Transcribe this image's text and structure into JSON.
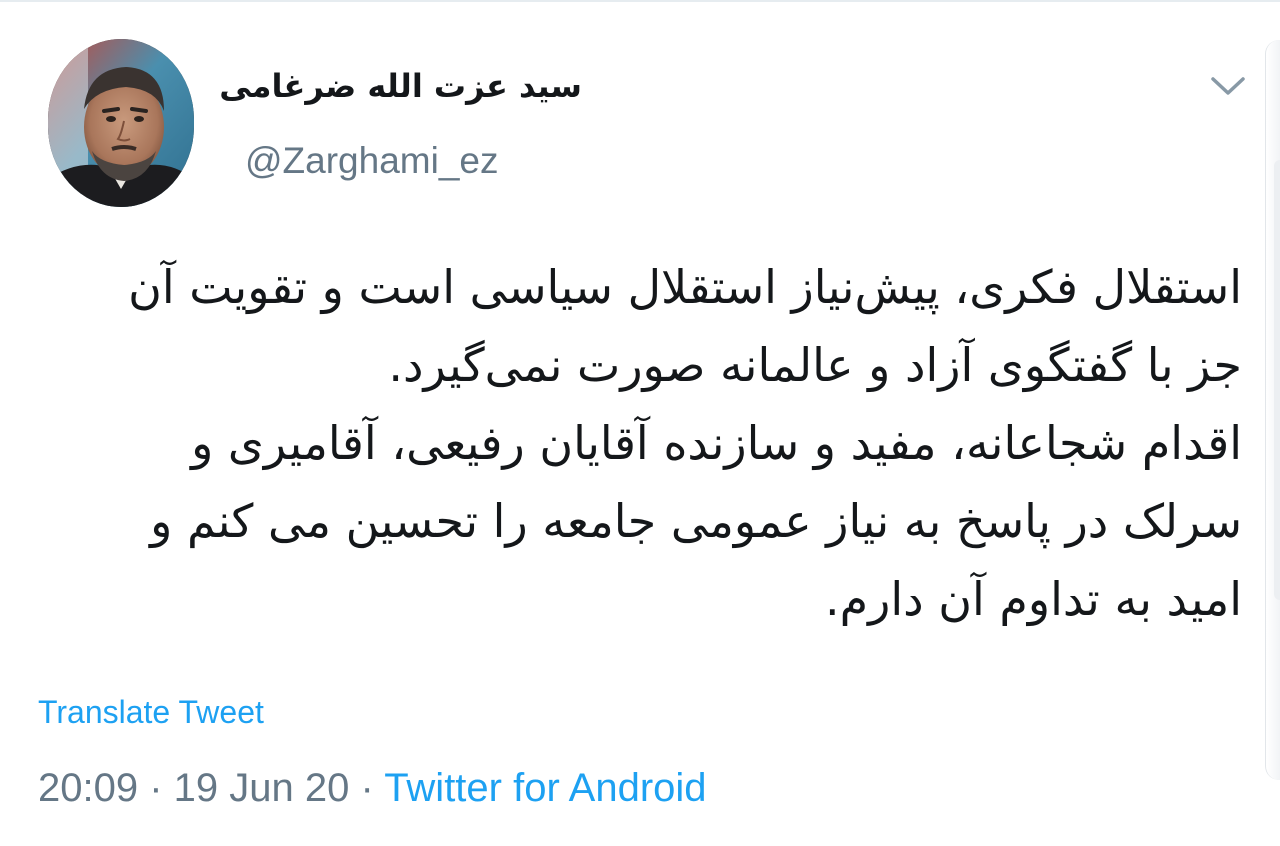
{
  "author": {
    "display_name": "سید عزت الله ضرغامی",
    "handle": "@Zarghami_ez"
  },
  "tweet": {
    "lines": [
      "استقلال فکری، پیش‌نیاز استقلال سیاسی است و تقویت آن",
      "جز با گفتگوی آزاد و عالمانه صورت نمی‌گیرد.",
      "اقدام شجاعانه، مفید و سازنده آقایان رفیعی، آقامیری و",
      "سرلک در پاسخ به نیاز عمومی جامعه را تحسین می کنم و",
      "امید به تداوم آن دارم."
    ],
    "translate_label": "Translate Tweet",
    "time": "20:09",
    "separator": " · ",
    "date": "19 Jun 20",
    "source": "Twitter for Android"
  },
  "icons": {
    "menu": "chevron-down-icon"
  },
  "colors": {
    "link": "#1da1f2",
    "secondary_text": "#657786",
    "primary_text": "#14171a"
  }
}
